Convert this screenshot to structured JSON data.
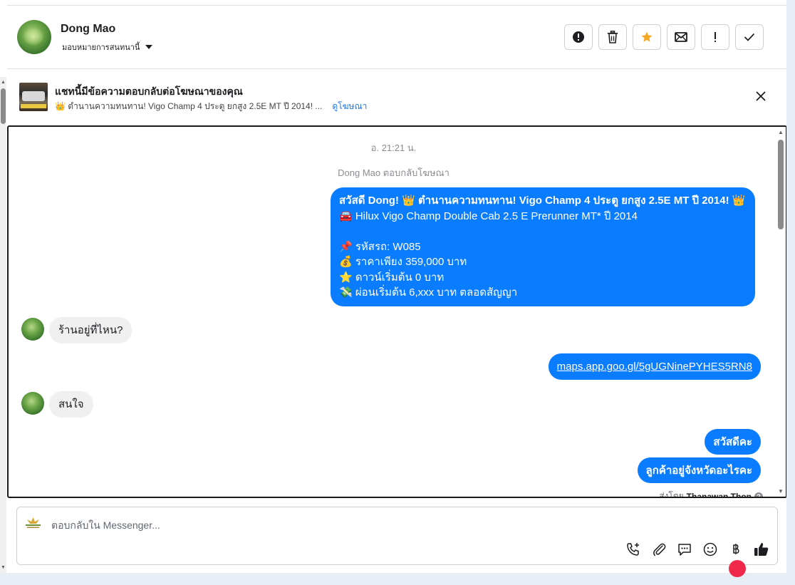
{
  "header": {
    "contact_name": "Dong Mao",
    "assign_label": "มอบหมายการสนทนานี้",
    "actions": [
      {
        "name": "report-button",
        "icon": "alert-circle-icon"
      },
      {
        "name": "delete-button",
        "icon": "trash-icon"
      },
      {
        "name": "star-button",
        "icon": "star-icon"
      },
      {
        "name": "mark-unread-button",
        "icon": "envelope-icon"
      },
      {
        "name": "follow-up-button",
        "icon": "exclamation-icon"
      },
      {
        "name": "done-button",
        "icon": "check-icon"
      }
    ]
  },
  "ad_banner": {
    "title": "แชทนี้มีข้อความตอบกลับต่อโฆษณาของคุณ",
    "subtitle": "👑 ตำนานความทนทาน! Vigo Champ 4 ประตู ยกสูง 2.5E MT ปี 2014! ...",
    "view_ad_label": "ดูโฆษณา"
  },
  "chat": {
    "timestamp": "อ. 21:21 น.",
    "replied_note": "Dong Mao ตอบกลับโฆษณา",
    "ad_message_lines": [
      "สวัสดี Dong! 👑 ตำนานความทนทาน! Vigo Champ 4 ประตู ยกสูง 2.5E MT ปี 2014! 👑",
      "🚘 Hilux Vigo Champ Double Cab 2.5 E Prerunner MT* ปี 2014",
      "",
      "📌 รหัสรถ: W085",
      "💰 ราคาเพียง 359,000 บาท",
      "⭐ ดาวน์เริ่มต้น 0 บาท",
      "💸 ผ่อนเริ่มต้น 6,xxx บาท ตลอดสัญญา"
    ],
    "incoming_1": "ร้านอยู่ที่ไหน?",
    "map_link": "maps.app.goo.gl/5gUGNinePYHES5RN8",
    "incoming_2": "สนใจ",
    "reply_greeting": "สวัสดีคะ",
    "reply_question": "ลูกค้าอยู่จังหวัดอะไรคะ",
    "sent_by_label": "ส่งโดย",
    "sent_by_name": "Thanawan Thon"
  },
  "composer": {
    "placeholder": "ตอบกลับใน Messenger...",
    "icons": [
      "phone-add-icon",
      "paperclip-icon",
      "saved-reply-icon",
      "emoji-icon",
      "baht-icon",
      "thumbs-up-icon"
    ]
  },
  "colors": {
    "outgoing_bubble": "#0a7cff",
    "incoming_bubble": "#f0f0f0",
    "star": "#f5a623",
    "link": "#1877f2"
  }
}
